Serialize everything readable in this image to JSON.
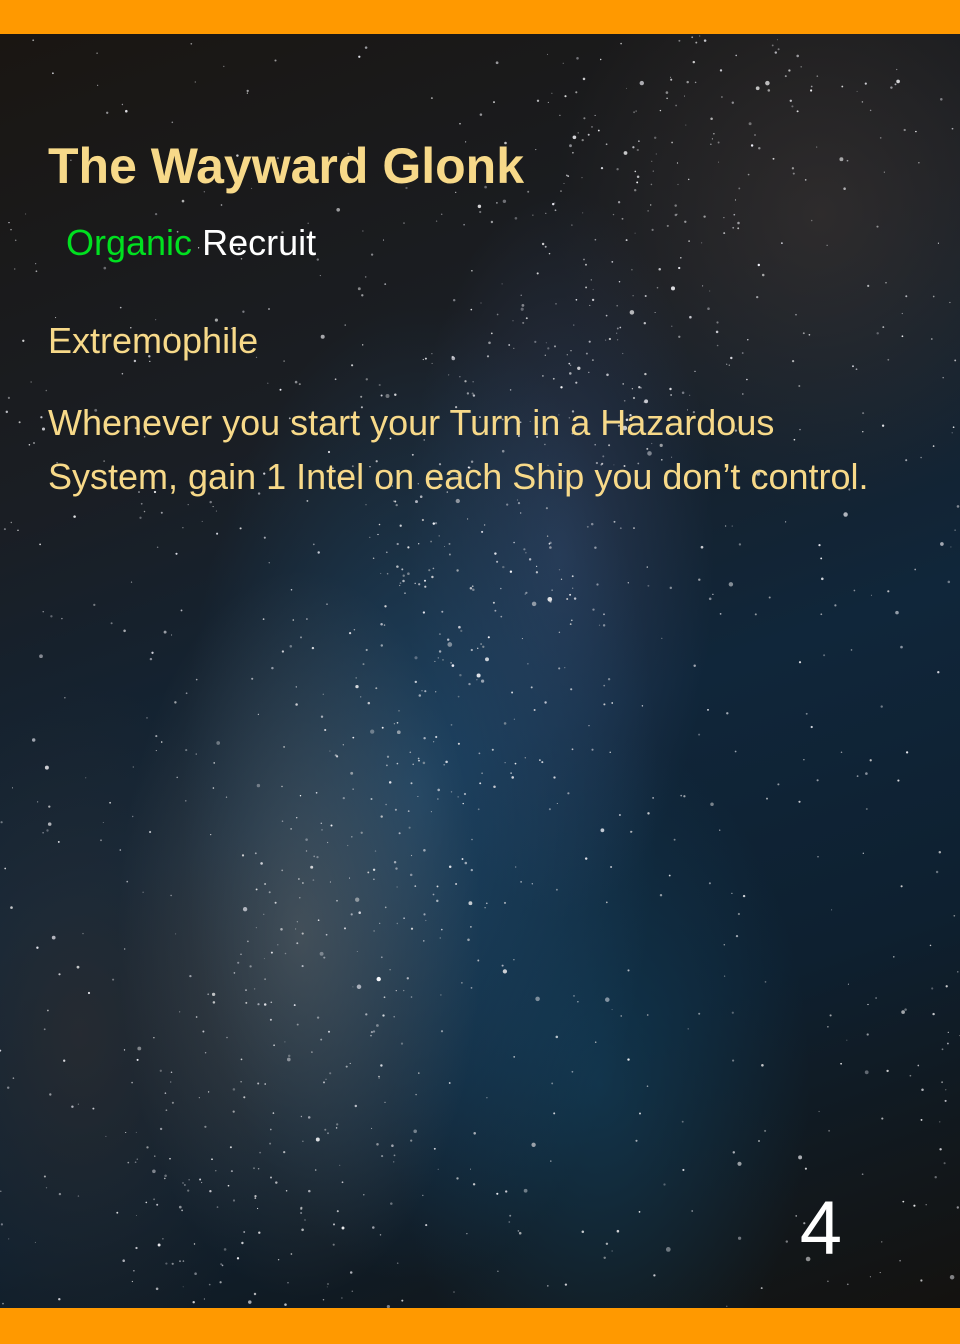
{
  "card": {
    "title": "The Wayward Glonk",
    "type": "Organic",
    "role": "Recruit",
    "ability_name": "Extremophile",
    "ability_text": "Whenever you start your Turn in a Hazardous System, gain 1 Intel on each Ship you don’t control.",
    "cost": "4"
  },
  "colors": {
    "band": "#ff9900",
    "title_text": "#f7d989",
    "type_text": "#00e020",
    "role_text": "#ffffff",
    "cost_text": "#ffffff"
  }
}
